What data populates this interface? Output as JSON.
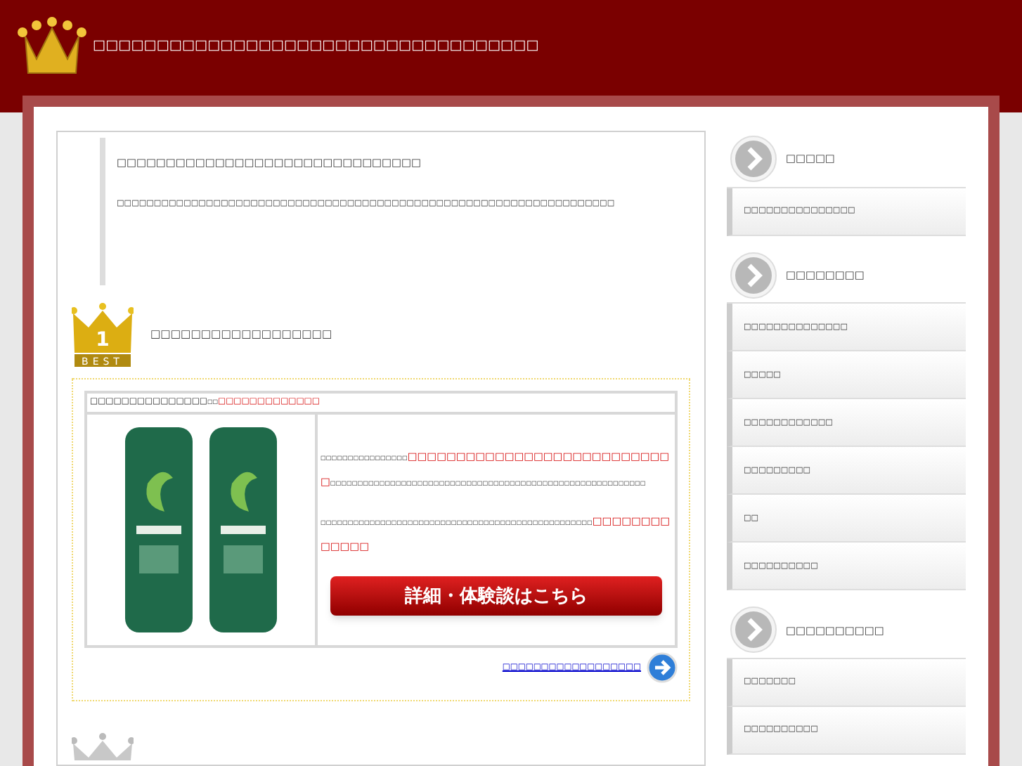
{
  "header": {
    "site_title": "□□□□□□□□□□□□□□□□□□□□□□□□□□□□□□□□□□□"
  },
  "intro": {
    "heading": "□□□□□□□□□□□□□□□□□□□□□□□□□□□□□□□",
    "text": "□□□□□□□□□□□□□□□□□□□□□□□□□□□□□□□□□□□□□□□□□□□□□□□□□□□□□□□□□□□□□□□□□□□"
  },
  "ranking": [
    {
      "rank_label": "1",
      "badge_text": "BEST",
      "title": "□□□□□□□□□□□□□□□□□□",
      "product_name": "□□□□□□□□□□□□□□□",
      "product_note": "□□",
      "product_tagline": "□□□□□□□□□□□□□",
      "descriptions": [
        {
          "parts": [
            {
              "text": "□□□□□□□□□□□□□□□□",
              "emphasis": false
            },
            {
              "text": "□□□□□□□□□□□□□□□□□□□□□□□□□□□□",
              "emphasis": true
            },
            {
              "text": "□□□□□□□□□□□□□□□□□□□□□□□□□□□□□□□□□□□□□□□□□□□□□□□□□□□□□□□□□□",
              "emphasis": false
            }
          ]
        },
        {
          "parts": [
            {
              "text": "□□□□□□□□□□□□□□□□□□□□□□□□□□□□□□□□□□□□□□□□□□□□□□□□□□",
              "emphasis": false
            },
            {
              "text": "□□□□□□□□□□□□□",
              "emphasis": true
            }
          ]
        }
      ],
      "button_label": "詳細・体験談はこちら",
      "more_link": "□□□□□□□□□□□□□□□□□□"
    }
  ],
  "sidebar": [
    {
      "heading": "□□□□□",
      "items": [
        "□□□□□□□□□□□□□□□"
      ]
    },
    {
      "heading": "□□□□□□□□",
      "items": [
        "□□□□□□□□□□□□□□",
        "□□□□□",
        "□□□□□□□□□□□□",
        "□□□□□□□□□",
        "□□",
        "□□□□□□□□□□"
      ]
    },
    {
      "heading": "□□□□□□□□□□",
      "items": [
        "□□□□□□□",
        "□□□□□□□□□□"
      ]
    }
  ]
}
